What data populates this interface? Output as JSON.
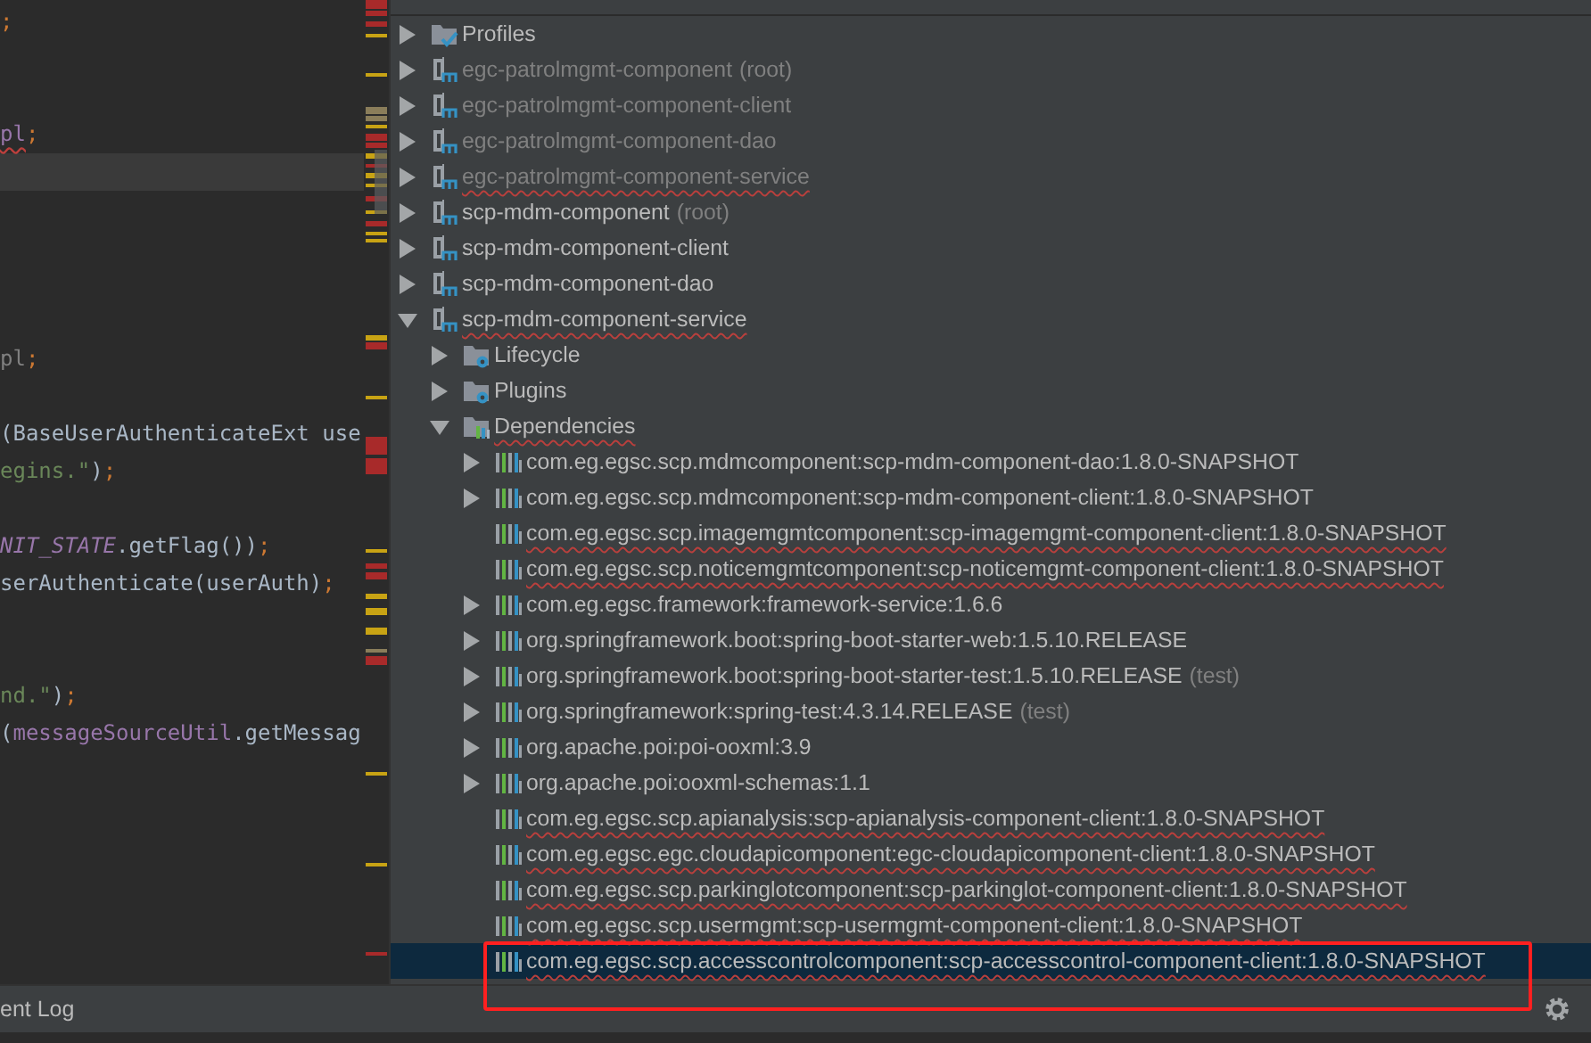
{
  "editor": {
    "code_lines": [
      {
        "kind": "code",
        "segments": [
          {
            "text": ";",
            "kind": "punct"
          }
        ]
      },
      {
        "kind": "blank"
      },
      {
        "kind": "blank"
      },
      {
        "kind": "code",
        "segments": [
          {
            "text": "pl",
            "kind": "error"
          },
          {
            "text": ";",
            "kind": "punct"
          }
        ]
      },
      {
        "kind": "caret_line"
      },
      {
        "kind": "blank"
      },
      {
        "kind": "blank"
      },
      {
        "kind": "blank"
      },
      {
        "kind": "blank"
      },
      {
        "kind": "code",
        "segments": [
          {
            "text": "pl",
            "kind": "unused"
          },
          {
            "text": ";",
            "kind": "punct"
          }
        ]
      },
      {
        "kind": "blank"
      },
      {
        "kind": "code",
        "segments": [
          {
            "text": "(BaseUserAuthenticateExt use",
            "kind": "plain"
          }
        ]
      },
      {
        "kind": "code",
        "segments": [
          {
            "text": "egins.\"",
            "kind": "string"
          },
          {
            "text": ")",
            "kind": "plain"
          },
          {
            "text": ";",
            "kind": "punct"
          }
        ]
      },
      {
        "kind": "blank"
      },
      {
        "kind": "code",
        "segments": [
          {
            "text": "NIT_STATE",
            "kind": "static"
          },
          {
            "text": ".getFlag())",
            "kind": "plain"
          },
          {
            "text": ";",
            "kind": "punct"
          }
        ]
      },
      {
        "kind": "code",
        "segments": [
          {
            "text": "serAuthenticate(userAuth)",
            "kind": "plain"
          },
          {
            "text": ";",
            "kind": "punct"
          }
        ]
      },
      {
        "kind": "blank"
      },
      {
        "kind": "blank"
      },
      {
        "kind": "code",
        "segments": [
          {
            "text": "nd.\"",
            "kind": "string"
          },
          {
            "text": ")",
            "kind": "plain"
          },
          {
            "text": ";",
            "kind": "punct"
          }
        ]
      },
      {
        "kind": "code",
        "segments": [
          {
            "text": "(",
            "kind": "plain"
          },
          {
            "text": "messageSourceUtil",
            "kind": "field"
          },
          {
            "text": ".getMessag",
            "kind": "plain"
          }
        ]
      }
    ]
  },
  "maven_tree": [
    {
      "label": "Profiles",
      "kind": "profiles",
      "expanded": false,
      "ignored": false,
      "error": false,
      "selected": false
    },
    {
      "label": "egc-patrolmgmt-component",
      "suffix": "(root)",
      "kind": "module",
      "expanded": false,
      "ignored": true,
      "error": false,
      "selected": false
    },
    {
      "label": "egc-patrolmgmt-component-client",
      "kind": "module",
      "expanded": false,
      "ignored": true,
      "error": false,
      "selected": false
    },
    {
      "label": "egc-patrolmgmt-component-dao",
      "kind": "module",
      "expanded": false,
      "ignored": true,
      "error": false,
      "selected": false
    },
    {
      "label": "egc-patrolmgmt-component-service",
      "kind": "module",
      "expanded": false,
      "ignored": true,
      "error": true,
      "selected": false
    },
    {
      "label": "scp-mdm-component",
      "suffix": "(root)",
      "kind": "module",
      "expanded": false,
      "ignored": false,
      "error": false,
      "selected": false
    },
    {
      "label": "scp-mdm-component-client",
      "kind": "module",
      "expanded": false,
      "ignored": false,
      "error": false,
      "selected": false
    },
    {
      "label": "scp-mdm-component-dao",
      "kind": "module",
      "expanded": false,
      "ignored": false,
      "error": false,
      "selected": false
    },
    {
      "label": "scp-mdm-component-service",
      "kind": "module",
      "expanded": true,
      "ignored": false,
      "error": true,
      "selected": false,
      "children": [
        {
          "label": "Lifecycle",
          "kind": "lifecycle",
          "expanded": false,
          "ignored": false,
          "error": false,
          "selected": false
        },
        {
          "label": "Plugins",
          "kind": "plugins",
          "expanded": false,
          "ignored": false,
          "error": false,
          "selected": false
        },
        {
          "label": "Dependencies",
          "kind": "dependencies",
          "expanded": true,
          "ignored": false,
          "error": true,
          "selected": false,
          "children": [
            {
              "label": "com.eg.egsc.scp.mdmcomponent:scp-mdm-component-dao:1.8.0-SNAPSHOT",
              "kind": "library",
              "expanded": false,
              "ignored": false,
              "error": false,
              "selected": false
            },
            {
              "label": "com.eg.egsc.scp.mdmcomponent:scp-mdm-component-client:1.8.0-SNAPSHOT",
              "kind": "library",
              "expanded": false,
              "ignored": false,
              "error": false,
              "selected": false
            },
            {
              "label": "com.eg.egsc.scp.imagemgmtcomponent:scp-imagemgmt-component-client:1.8.0-SNAPSHOT",
              "kind": "library",
              "ignored": false,
              "error": true,
              "selected": false
            },
            {
              "label": "com.eg.egsc.scp.noticemgmtcomponent:scp-noticemgmt-component-client:1.8.0-SNAPSHOT",
              "kind": "library",
              "ignored": false,
              "error": true,
              "selected": false
            },
            {
              "label": "com.eg.egsc.framework:framework-service:1.6.6",
              "kind": "library",
              "expanded": false,
              "ignored": false,
              "error": false,
              "selected": false
            },
            {
              "label": "org.springframework.boot:spring-boot-starter-web:1.5.10.RELEASE",
              "kind": "library",
              "expanded": false,
              "ignored": false,
              "error": false,
              "selected": false
            },
            {
              "label": "org.springframework.boot:spring-boot-starter-test:1.5.10.RELEASE",
              "suffix": "(test)",
              "kind": "library",
              "expanded": false,
              "ignored": false,
              "error": false,
              "selected": false
            },
            {
              "label": "org.springframework:spring-test:4.3.14.RELEASE",
              "suffix": "(test)",
              "kind": "library",
              "expanded": false,
              "ignored": false,
              "error": false,
              "selected": false
            },
            {
              "label": "org.apache.poi:poi-ooxml:3.9",
              "kind": "library",
              "expanded": false,
              "ignored": false,
              "error": false,
              "selected": false
            },
            {
              "label": "org.apache.poi:ooxml-schemas:1.1",
              "kind": "library",
              "expanded": false,
              "ignored": false,
              "error": false,
              "selected": false
            },
            {
              "label": "com.eg.egsc.scp.apianalysis:scp-apianalysis-component-client:1.8.0-SNAPSHOT",
              "kind": "library",
              "ignored": false,
              "error": true,
              "selected": false
            },
            {
              "label": "com.eg.egsc.egc.cloudapicomponent:egc-cloudapicomponent-client:1.8.0-SNAPSHOT",
              "kind": "library",
              "ignored": false,
              "error": true,
              "selected": false
            },
            {
              "label": "com.eg.egsc.scp.parkinglotcomponent:scp-parkinglot-component-client:1.8.0-SNAPSHOT",
              "kind": "library",
              "ignored": false,
              "error": true,
              "selected": false
            },
            {
              "label": "com.eg.egsc.scp.usermgmt:scp-usermgmt-component-client:1.8.0-SNAPSHOT",
              "kind": "library",
              "ignored": false,
              "error": true,
              "selected": false
            },
            {
              "label": "com.eg.egsc.scp.accesscontrolcomponent:scp-accesscontrol-component-client:1.8.0-SNAPSHOT",
              "kind": "library",
              "ignored": false,
              "error": true,
              "selected": true
            }
          ]
        }
      ]
    }
  ],
  "bottom_bar": {
    "tool_window": "ent Log"
  }
}
